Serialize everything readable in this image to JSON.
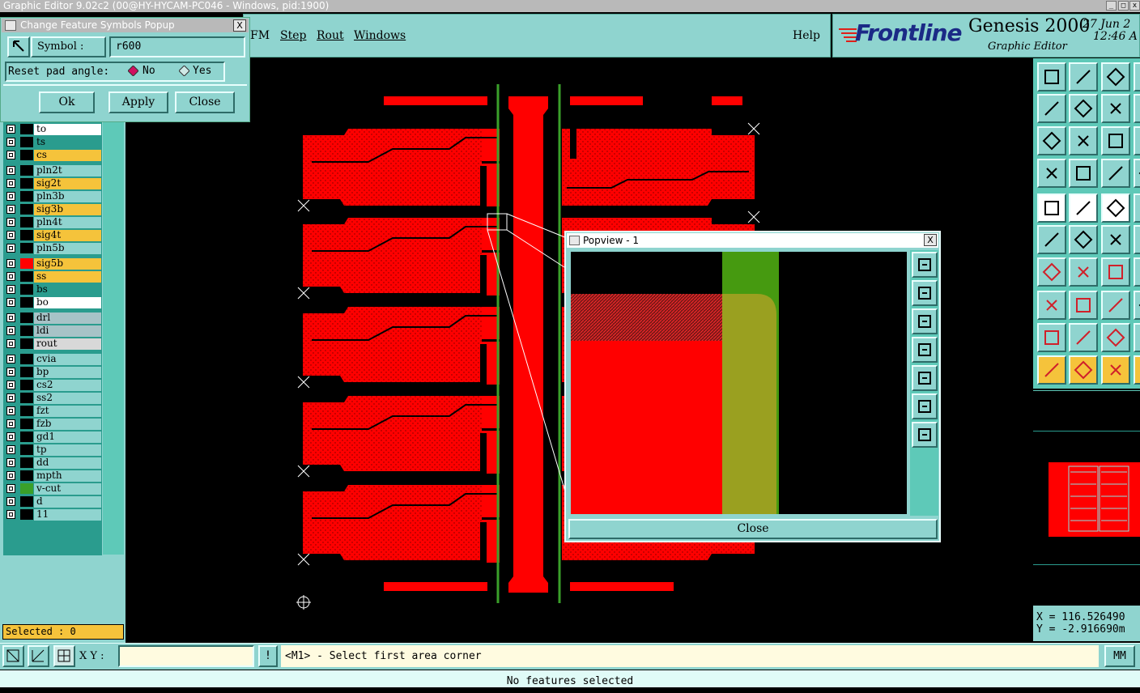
{
  "window": {
    "title": "Graphic Editor 9.02c2 (00@HY-HYCAM-PC046 - Windows, pid:1900)",
    "min_btn": "_",
    "max_btn": "□",
    "close_btn": "x"
  },
  "menu": {
    "items": [
      "FM",
      "Step",
      "Rout",
      "Windows"
    ],
    "help": "Help"
  },
  "brand": {
    "logo": "Frontline",
    "product": "Genesis 2000",
    "subtitle": "Graphic Editor",
    "date": "27 Jun 2",
    "time": "12:46 A"
  },
  "symbol_popup": {
    "title": "Change Feature Symbols Popup",
    "close_btn": "X",
    "symbol_label": "Symbol :",
    "symbol_value": "r600",
    "reset_label": "Reset pad angle:",
    "no_label": "No",
    "yes_label": "Yes",
    "ok": "Ok",
    "apply": "Apply",
    "close": "Close",
    "selected_option": "No"
  },
  "layers": [
    {
      "name": "to",
      "color": "#ffffff",
      "swatch": "#000000"
    },
    {
      "name": "ts",
      "color": "#2a9c8e",
      "swatch": "#000000"
    },
    {
      "name": "cs",
      "color": "#f5c33b",
      "swatch": "#000000"
    },
    {
      "name": "pln2t",
      "color": "#8fd4cf",
      "swatch": "#000000"
    },
    {
      "name": "sig2t",
      "color": "#f5c33b",
      "swatch": "#000000"
    },
    {
      "name": "pln3b",
      "color": "#8fd4cf",
      "swatch": "#000000"
    },
    {
      "name": "sig3b",
      "color": "#f5c33b",
      "swatch": "#000000"
    },
    {
      "name": "pln4t",
      "color": "#8fd4cf",
      "swatch": "#000000"
    },
    {
      "name": "sig4t",
      "color": "#f5c33b",
      "swatch": "#000000"
    },
    {
      "name": "pln5b",
      "color": "#8fd4cf",
      "swatch": "#000000"
    },
    {
      "name": "sig5b",
      "color": "#f5c33b",
      "swatch": "#ff0000"
    },
    {
      "name": "ss",
      "color": "#f5c33b",
      "swatch": "#000000"
    },
    {
      "name": "bs",
      "color": "#2a9c8e",
      "swatch": "#000000"
    },
    {
      "name": "bo",
      "color": "#ffffff",
      "swatch": "#000000"
    },
    {
      "name": "drl",
      "color": "#a7c3c7",
      "swatch": "#000000"
    },
    {
      "name": "ldi",
      "color": "#a7c3c7",
      "swatch": "#000000"
    },
    {
      "name": "rout",
      "color": "#d8d8d8",
      "swatch": "#000000"
    },
    {
      "name": "cvia",
      "color": "#8fd4cf",
      "swatch": "#000000"
    },
    {
      "name": "bp",
      "color": "#8fd4cf",
      "swatch": "#000000"
    },
    {
      "name": "cs2",
      "color": "#8fd4cf",
      "swatch": "#000000"
    },
    {
      "name": "ss2",
      "color": "#8fd4cf",
      "swatch": "#000000"
    },
    {
      "name": "fzt",
      "color": "#8fd4cf",
      "swatch": "#000000"
    },
    {
      "name": "fzb",
      "color": "#8fd4cf",
      "swatch": "#000000"
    },
    {
      "name": "gd1",
      "color": "#8fd4cf",
      "swatch": "#000000"
    },
    {
      "name": "tp",
      "color": "#8fd4cf",
      "swatch": "#000000"
    },
    {
      "name": "dd",
      "color": "#8fd4cf",
      "swatch": "#000000"
    },
    {
      "name": "mpth",
      "color": "#8fd4cf",
      "swatch": "#000000"
    },
    {
      "name": "v-cut",
      "color": "#8fd4cf",
      "swatch": "#3aa02a"
    },
    {
      "name": "d",
      "color": "#8fd4cf",
      "swatch": "#000000"
    },
    {
      "name": "11",
      "color": "#8fd4cf",
      "swatch": "#000000"
    }
  ],
  "selected_count": "Selected : 0",
  "popview": {
    "title": "Popview - 1",
    "close_x": "X",
    "close": "Close"
  },
  "coords": {
    "x": "X = 116.526490",
    "y": "Y = -2.916690m"
  },
  "bottom": {
    "xy_label": "X Y :",
    "xy_value": "",
    "exclaim": "!",
    "prompt": "<M1> - Select first area corner",
    "units": "MM",
    "status": "No features selected"
  },
  "colors": {
    "panel": "#8fd4cf",
    "accent": "#f5c33b",
    "copper": "#ff0000",
    "vcut": "#3aa02a"
  }
}
